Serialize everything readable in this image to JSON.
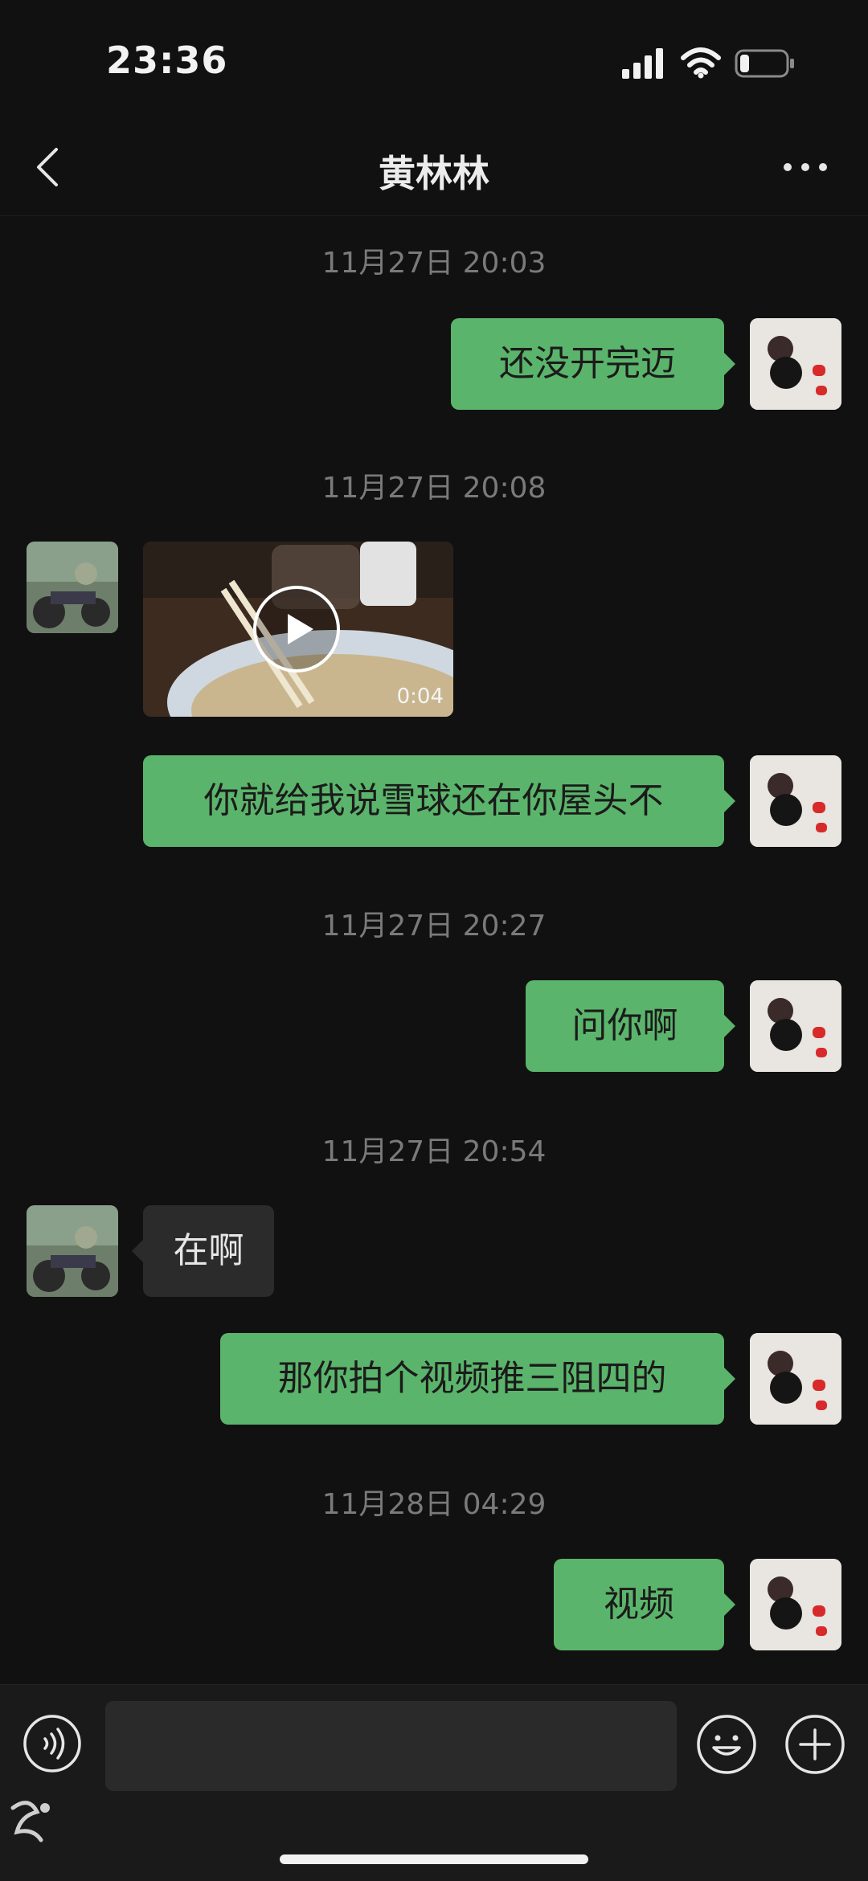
{
  "status_bar": {
    "time": "23:36",
    "icons": [
      "signal-icon",
      "wifi-icon",
      "battery-icon"
    ],
    "battery_level": 0.2
  },
  "nav": {
    "title": "黄林林",
    "back_icon": "chevron-left-icon",
    "more_icon": "more-dots-icon"
  },
  "messages": [
    {
      "type": "timestamp",
      "text": "11月27日 20:03"
    },
    {
      "type": "text",
      "from": "me",
      "text": "还没开完迈"
    },
    {
      "type": "timestamp",
      "text": "11月27日 20:08"
    },
    {
      "type": "video",
      "from": "other",
      "duration": "0:04"
    },
    {
      "type": "text",
      "from": "me",
      "text": "你就给我说雪球还在你屋头不"
    },
    {
      "type": "timestamp",
      "text": "11月27日 20:27"
    },
    {
      "type": "text",
      "from": "me",
      "text": "问你啊"
    },
    {
      "type": "timestamp",
      "text": "11月27日 20:54"
    },
    {
      "type": "text",
      "from": "other",
      "text": "在啊"
    },
    {
      "type": "text",
      "from": "me",
      "text": "那你拍个视频推三阻四的"
    },
    {
      "type": "timestamp",
      "text": "11月28日 04:29"
    },
    {
      "type": "text",
      "from": "me",
      "text": "视频"
    }
  ],
  "input_bar": {
    "voice_icon": "voice-icon",
    "emoji_icon": "emoji-icon",
    "plus_icon": "plus-icon",
    "text_value": ""
  },
  "colors": {
    "background": "#111111",
    "bubble_me": "#5bb46b",
    "bubble_other": "#2b2b2b",
    "timestamp": "#7a7a7a"
  }
}
